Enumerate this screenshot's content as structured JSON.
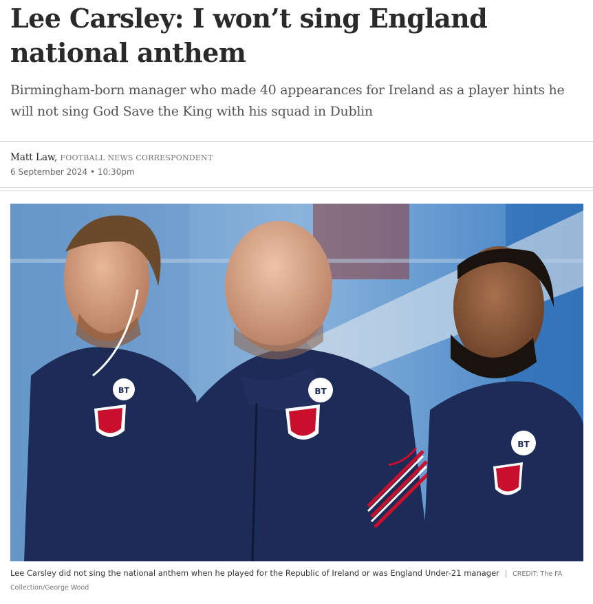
{
  "article": {
    "headline": "Lee Carsley: I won’t sing England national anthem",
    "standfirst": "Birmingham-born manager who made 40 appearances for Ireland as a player hints he will not sing God Save the King with his squad in Dublin",
    "author": "Matt Law,",
    "author_role": "FOOTBALL NEWS CORRESPONDENT",
    "date": "6 September 2024 • 10:30pm"
  },
  "image": {
    "alt": "Lee Carsley, Jimmy Brown? and Ashley Cole stand in England tracksuits during the anthem",
    "badge_text": "BT"
  },
  "caption": {
    "text": "Lee Carsley did not sing the national anthem when he played for the Republic of Ireland or was England Under-21 manager",
    "separator": "|",
    "credit": "CREDIT: The FA Collection/George Wood"
  },
  "colors": {
    "headline": "#2a2a2a",
    "standfirst": "#555555",
    "jacket_navy": "#1d2b57",
    "crest_red": "#c8102e",
    "stadium_blue": "#4b8fd0"
  }
}
